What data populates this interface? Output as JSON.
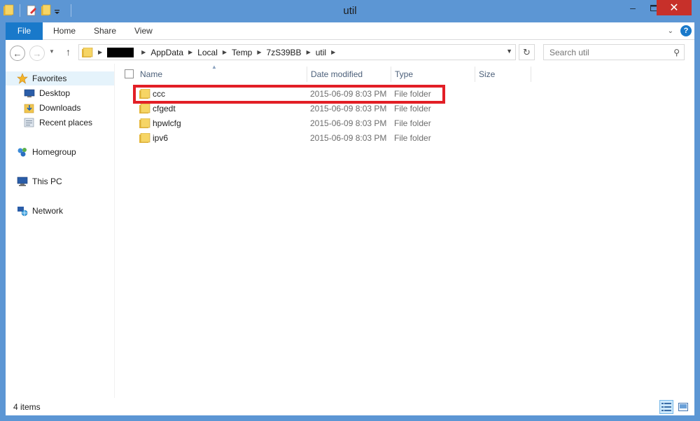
{
  "window": {
    "title": "util",
    "controls": {
      "minimize": "–",
      "maximize": "☐",
      "close": "✕"
    }
  },
  "ribbon": {
    "tabs": [
      "File",
      "Home",
      "Share",
      "View"
    ]
  },
  "address_bar": {
    "breadcrumbs": [
      "AppData",
      "Local",
      "Temp",
      "7zS39BB",
      "util"
    ],
    "search_placeholder": "Search util"
  },
  "nav_pane": {
    "favorites_label": "Favorites",
    "favorites": [
      {
        "label": "Desktop",
        "icon": "desktop-icon"
      },
      {
        "label": "Downloads",
        "icon": "downloads-icon"
      },
      {
        "label": "Recent places",
        "icon": "recent-places-icon"
      }
    ],
    "homegroup": "Homegroup",
    "this_pc": "This PC",
    "network": "Network"
  },
  "columns": [
    "Name",
    "Date modified",
    "Type",
    "Size"
  ],
  "files": [
    {
      "name": "ccc",
      "date": "2015-06-09 8:03 PM",
      "type": "File folder",
      "size": ""
    },
    {
      "name": "cfgedt",
      "date": "2015-06-09 8:03 PM",
      "type": "File folder",
      "size": ""
    },
    {
      "name": "hpwlcfg",
      "date": "2015-06-09 8:03 PM",
      "type": "File folder",
      "size": ""
    },
    {
      "name": "ipv6",
      "date": "2015-06-09 8:03 PM",
      "type": "File folder",
      "size": ""
    }
  ],
  "status": {
    "item_count": "4 items"
  },
  "colors": {
    "titlebar": "#5c96d4",
    "file_tab": "#1979ca",
    "close_button": "#c7302a",
    "highlight_border": "#e21f26",
    "folder_yellow": "#f1c64f"
  }
}
